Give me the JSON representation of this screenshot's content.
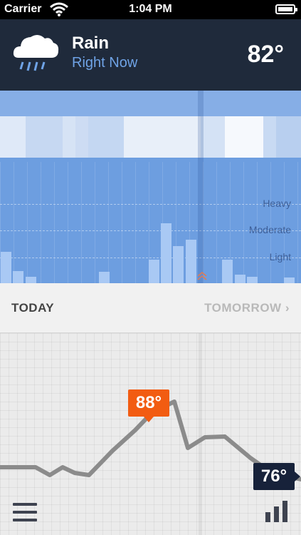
{
  "status_bar": {
    "carrier": "Carrier",
    "time": "1:04 PM"
  },
  "header": {
    "condition": "Rain",
    "subtitle": "Right Now",
    "temperature": "82°",
    "icon": "rain-cloud-icon"
  },
  "precipitation": {
    "levels": [
      "Heavy",
      "Moderate",
      "Light"
    ],
    "accent_color": "#6d9ee0",
    "bar_intensity": [
      0.38,
      0.15,
      0.08,
      0,
      0,
      0,
      0,
      0,
      0.14,
      0,
      0,
      0,
      0.29,
      0.73,
      0.45,
      0.53,
      0,
      0,
      0.29,
      0.1,
      0.08,
      0,
      0,
      0.07
    ]
  },
  "tabs": {
    "today": "TODAY",
    "tomorrow": "TOMORROW"
  },
  "temperature_chart": {
    "high": "88°",
    "low": "76°",
    "high_color": "#f25c12",
    "low_color": "#17223a"
  },
  "toolbar": {
    "menu_icon": "menu-icon",
    "stats_icon": "bar-chart-icon"
  }
}
